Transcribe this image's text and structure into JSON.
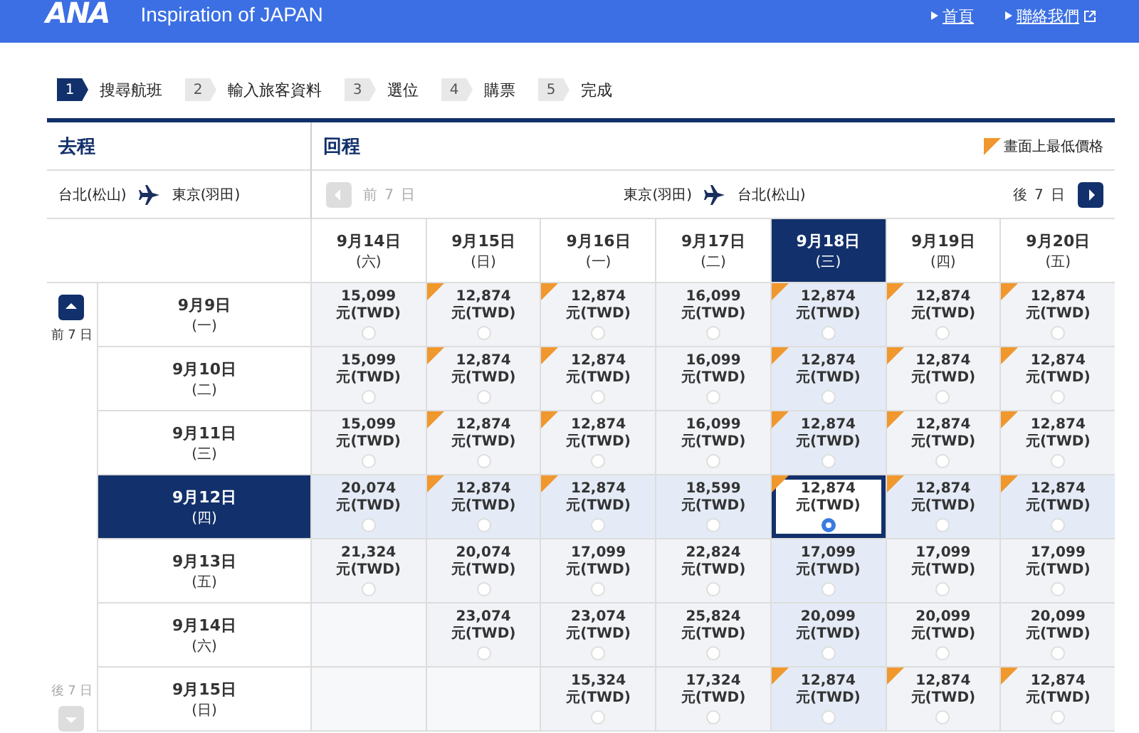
{
  "header": {
    "logo": "ANA",
    "tagline": "Inspiration of JAPAN",
    "links": [
      "首頁",
      "聯絡我們"
    ]
  },
  "steps": [
    {
      "number": "1",
      "label": "搜尋航班",
      "selected": true
    },
    {
      "number": "2",
      "label": "輸入旅客資料",
      "selected": false
    },
    {
      "number": "3",
      "label": "選位",
      "selected": false
    },
    {
      "number": "4",
      "label": "購票",
      "selected": false
    },
    {
      "number": "5",
      "label": "完成",
      "selected": false
    }
  ],
  "outbound": {
    "title": "去程",
    "from": "台北(松山)",
    "to": "東京(羽田)",
    "prev": {
      "label": "前 7 日",
      "disabled": false
    },
    "next": {
      "label": "後 7 日",
      "disabled": true
    }
  },
  "inbound": {
    "title": "回程",
    "legend": "畫面上最低價格",
    "from": "東京(羽田)",
    "to": "台北(松山)",
    "prev": {
      "label": "前 7 日",
      "disabled": true
    },
    "next": {
      "label": "後 7 日",
      "disabled": false
    }
  },
  "columns": [
    {
      "date": "9月14日",
      "weekday": "(六)",
      "selected": false
    },
    {
      "date": "9月15日",
      "weekday": "(日)",
      "selected": false
    },
    {
      "date": "9月16日",
      "weekday": "(一)",
      "selected": false
    },
    {
      "date": "9月17日",
      "weekday": "(二)",
      "selected": false
    },
    {
      "date": "9月18日",
      "weekday": "(三)",
      "selected": true
    },
    {
      "date": "9月19日",
      "weekday": "(四)",
      "selected": false
    },
    {
      "date": "9月20日",
      "weekday": "(五)",
      "selected": false
    }
  ],
  "rows": [
    {
      "date": "9月9日",
      "weekday": "(一)",
      "selected": false,
      "cells": [
        {
          "kind": "fare",
          "price": "15,099",
          "currency": "元(TWD)",
          "lowest": false,
          "selected": false
        },
        {
          "kind": "fare",
          "price": "12,874",
          "currency": "元(TWD)",
          "lowest": true,
          "selected": false
        },
        {
          "kind": "fare",
          "price": "12,874",
          "currency": "元(TWD)",
          "lowest": true,
          "selected": false
        },
        {
          "kind": "fare",
          "price": "16,099",
          "currency": "元(TWD)",
          "lowest": false,
          "selected": false
        },
        {
          "kind": "fare",
          "price": "12,874",
          "currency": "元(TWD)",
          "lowest": true,
          "selected": false
        },
        {
          "kind": "fare",
          "price": "12,874",
          "currency": "元(TWD)",
          "lowest": true,
          "selected": false
        },
        {
          "kind": "fare",
          "price": "12,874",
          "currency": "元(TWD)",
          "lowest": true,
          "selected": false
        }
      ]
    },
    {
      "date": "9月10日",
      "weekday": "(二)",
      "selected": false,
      "cells": [
        {
          "kind": "fare",
          "price": "15,099",
          "currency": "元(TWD)",
          "lowest": false,
          "selected": false
        },
        {
          "kind": "fare",
          "price": "12,874",
          "currency": "元(TWD)",
          "lowest": true,
          "selected": false
        },
        {
          "kind": "fare",
          "price": "12,874",
          "currency": "元(TWD)",
          "lowest": true,
          "selected": false
        },
        {
          "kind": "fare",
          "price": "16,099",
          "currency": "元(TWD)",
          "lowest": false,
          "selected": false
        },
        {
          "kind": "fare",
          "price": "12,874",
          "currency": "元(TWD)",
          "lowest": true,
          "selected": false
        },
        {
          "kind": "fare",
          "price": "12,874",
          "currency": "元(TWD)",
          "lowest": true,
          "selected": false
        },
        {
          "kind": "fare",
          "price": "12,874",
          "currency": "元(TWD)",
          "lowest": true,
          "selected": false
        }
      ]
    },
    {
      "date": "9月11日",
      "weekday": "(三)",
      "selected": false,
      "cells": [
        {
          "kind": "fare",
          "price": "15,099",
          "currency": "元(TWD)",
          "lowest": false,
          "selected": false
        },
        {
          "kind": "fare",
          "price": "12,874",
          "currency": "元(TWD)",
          "lowest": true,
          "selected": false
        },
        {
          "kind": "fare",
          "price": "12,874",
          "currency": "元(TWD)",
          "lowest": true,
          "selected": false
        },
        {
          "kind": "fare",
          "price": "16,099",
          "currency": "元(TWD)",
          "lowest": false,
          "selected": false
        },
        {
          "kind": "fare",
          "price": "12,874",
          "currency": "元(TWD)",
          "lowest": true,
          "selected": false
        },
        {
          "kind": "fare",
          "price": "12,874",
          "currency": "元(TWD)",
          "lowest": true,
          "selected": false
        },
        {
          "kind": "fare",
          "price": "12,874",
          "currency": "元(TWD)",
          "lowest": true,
          "selected": false
        }
      ]
    },
    {
      "date": "9月12日",
      "weekday": "(四)",
      "selected": true,
      "cells": [
        {
          "kind": "fare",
          "price": "20,074",
          "currency": "元(TWD)",
          "lowest": false,
          "selected": false
        },
        {
          "kind": "fare",
          "price": "12,874",
          "currency": "元(TWD)",
          "lowest": true,
          "selected": false
        },
        {
          "kind": "fare",
          "price": "12,874",
          "currency": "元(TWD)",
          "lowest": true,
          "selected": false
        },
        {
          "kind": "fare",
          "price": "18,599",
          "currency": "元(TWD)",
          "lowest": false,
          "selected": false
        },
        {
          "kind": "fare",
          "price": "12,874",
          "currency": "元(TWD)",
          "lowest": true,
          "selected": true
        },
        {
          "kind": "fare",
          "price": "12,874",
          "currency": "元(TWD)",
          "lowest": true,
          "selected": false
        },
        {
          "kind": "fare",
          "price": "12,874",
          "currency": "元(TWD)",
          "lowest": true,
          "selected": false
        }
      ]
    },
    {
      "date": "9月13日",
      "weekday": "(五)",
      "selected": false,
      "cells": [
        {
          "kind": "fare",
          "price": "21,324",
          "currency": "元(TWD)",
          "lowest": false,
          "selected": false
        },
        {
          "kind": "fare",
          "price": "20,074",
          "currency": "元(TWD)",
          "lowest": false,
          "selected": false
        },
        {
          "kind": "fare",
          "price": "17,099",
          "currency": "元(TWD)",
          "lowest": false,
          "selected": false
        },
        {
          "kind": "fare",
          "price": "22,824",
          "currency": "元(TWD)",
          "lowest": false,
          "selected": false
        },
        {
          "kind": "fare",
          "price": "17,099",
          "currency": "元(TWD)",
          "lowest": false,
          "selected": false
        },
        {
          "kind": "fare",
          "price": "17,099",
          "currency": "元(TWD)",
          "lowest": false,
          "selected": false
        },
        {
          "kind": "fare",
          "price": "17,099",
          "currency": "元(TWD)",
          "lowest": false,
          "selected": false
        }
      ]
    },
    {
      "date": "9月14日",
      "weekday": "(六)",
      "selected": false,
      "cells": [
        {
          "kind": "empty"
        },
        {
          "kind": "fare",
          "price": "23,074",
          "currency": "元(TWD)",
          "lowest": false,
          "selected": false
        },
        {
          "kind": "fare",
          "price": "23,074",
          "currency": "元(TWD)",
          "lowest": false,
          "selected": false
        },
        {
          "kind": "fare",
          "price": "25,824",
          "currency": "元(TWD)",
          "lowest": false,
          "selected": false
        },
        {
          "kind": "fare",
          "price": "20,099",
          "currency": "元(TWD)",
          "lowest": false,
          "selected": false
        },
        {
          "kind": "fare",
          "price": "20,099",
          "currency": "元(TWD)",
          "lowest": false,
          "selected": false
        },
        {
          "kind": "fare",
          "price": "20,099",
          "currency": "元(TWD)",
          "lowest": false,
          "selected": false
        }
      ]
    },
    {
      "date": "9月15日",
      "weekday": "(日)",
      "selected": false,
      "cells": [
        {
          "kind": "empty"
        },
        {
          "kind": "empty"
        },
        {
          "kind": "fare",
          "price": "15,324",
          "currency": "元(TWD)",
          "lowest": false,
          "selected": false
        },
        {
          "kind": "fare",
          "price": "17,324",
          "currency": "元(TWD)",
          "lowest": false,
          "selected": false
        },
        {
          "kind": "fare",
          "price": "12,874",
          "currency": "元(TWD)",
          "lowest": true,
          "selected": false
        },
        {
          "kind": "fare",
          "price": "12,874",
          "currency": "元(TWD)",
          "lowest": true,
          "selected": false
        },
        {
          "kind": "fare",
          "price": "12,874",
          "currency": "元(TWD)",
          "lowest": true,
          "selected": false
        }
      ]
    }
  ]
}
